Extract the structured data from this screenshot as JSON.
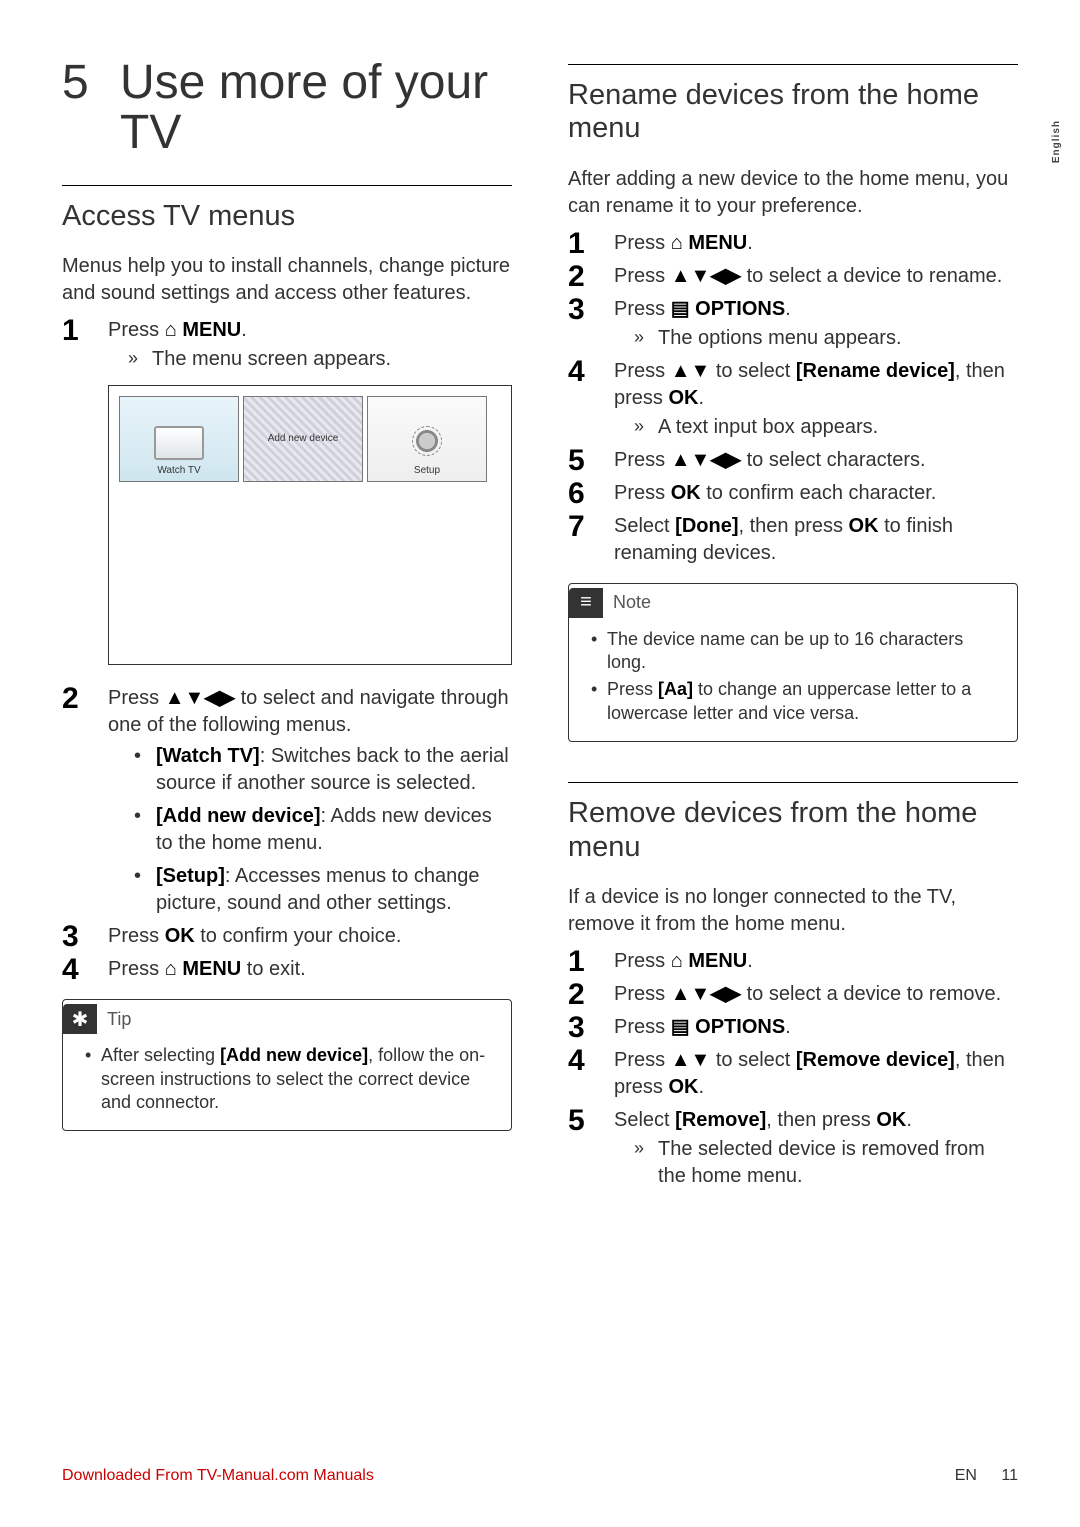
{
  "side_tab": "English",
  "chapter": {
    "number": "5",
    "title": "Use more of your TV"
  },
  "left": {
    "section_title": "Access TV menus",
    "intro": "Menus help you to install channels, change picture and sound settings and access other features.",
    "step1_prefix": "Press ",
    "step1_icon": "⌂",
    "step1_menu": " MENU",
    "step1_suffix": ".",
    "step1_result": "The menu screen appears.",
    "tiles": {
      "watch": "Watch TV",
      "add": "Add new device",
      "setup": "Setup"
    },
    "step2_prefix": "Press ",
    "step2_icons": "▲▼◀▶",
    "step2_suffix": " to select and navigate through one of the following menus.",
    "menu_watch_label": "[Watch TV]",
    "menu_watch_desc": ": Switches back to the aerial source if another source is selected.",
    "menu_add_label": "[Add new device]",
    "menu_add_desc": ": Adds new devices to the home menu.",
    "menu_setup_label": "[Setup]",
    "menu_setup_desc": ": Accesses menus to change picture, sound and other settings.",
    "step3_prefix": "Press ",
    "step3_ok": "OK",
    "step3_suffix": " to confirm your choice.",
    "step4_prefix": "Press ",
    "step4_icon": "⌂",
    "step4_menu": " MENU",
    "step4_suffix": " to exit.",
    "tip_title": "Tip",
    "tip_text_pre": "After selecting ",
    "tip_text_bold": "[Add new device]",
    "tip_text_post": ", follow the on-screen instructions to select the correct device and connector."
  },
  "right": {
    "rename": {
      "title": "Rename devices from the home menu",
      "intro": "After adding a new device to the home menu, you can rename it to your preference.",
      "s1_pre": "Press ",
      "s1_icon": "⌂",
      "s1_menu": " MENU",
      "s1_post": ".",
      "s2_pre": "Press ",
      "s2_icons": "▲▼◀▶",
      "s2_post": " to select a device to rename.",
      "s3_pre": "Press ",
      "s3_icon": "▤",
      "s3_opt": " OPTIONS",
      "s3_post": ".",
      "s3_result": "The options menu appears.",
      "s4_pre": "Press ",
      "s4_icons": "▲▼",
      "s4_mid": " to select ",
      "s4_bold": "[Rename device]",
      "s4_mid2": ", then press ",
      "s4_ok": "OK",
      "s4_post": ".",
      "s4_result": "A text input box appears.",
      "s5_pre": "Press ",
      "s5_icons": "▲▼◀▶",
      "s5_post": " to select characters.",
      "s6_pre": "Press ",
      "s6_ok": "OK",
      "s6_post": " to confirm each character.",
      "s7_pre": "Select ",
      "s7_bold": "[Done]",
      "s7_mid": ", then press ",
      "s7_ok": "OK",
      "s7_post": " to finish renaming devices.",
      "note_title": "Note",
      "note1": "The device name can be up to 16 characters long.",
      "note2_pre": "Press ",
      "note2_bold": "[Aa]",
      "note2_post": " to change an uppercase letter to a lowercase letter and vice versa."
    },
    "remove": {
      "title": "Remove devices from the home menu",
      "intro": "If a device is no longer connected to the TV, remove it from the home menu.",
      "s1_pre": "Press ",
      "s1_icon": "⌂",
      "s1_menu": " MENU",
      "s1_post": ".",
      "s2_pre": "Press ",
      "s2_icons": "▲▼◀▶",
      "s2_post": " to select a device to remove.",
      "s3_pre": "Press ",
      "s3_icon": "▤",
      "s3_opt": " OPTIONS",
      "s3_post": ".",
      "s4_pre": "Press ",
      "s4_icons": "▲▼",
      "s4_mid": " to select ",
      "s4_bold": "[Remove device]",
      "s4_mid2": ", then press ",
      "s4_ok": "OK",
      "s4_post": ".",
      "s5_pre": "Select ",
      "s5_bold": "[Remove]",
      "s5_mid": ", then press ",
      "s5_ok": "OK",
      "s5_post": ".",
      "s5_result": "The selected device is removed from the home menu."
    }
  },
  "footer": {
    "download": "Downloaded From TV-Manual.com Manuals",
    "lang": "EN",
    "page": "11"
  }
}
